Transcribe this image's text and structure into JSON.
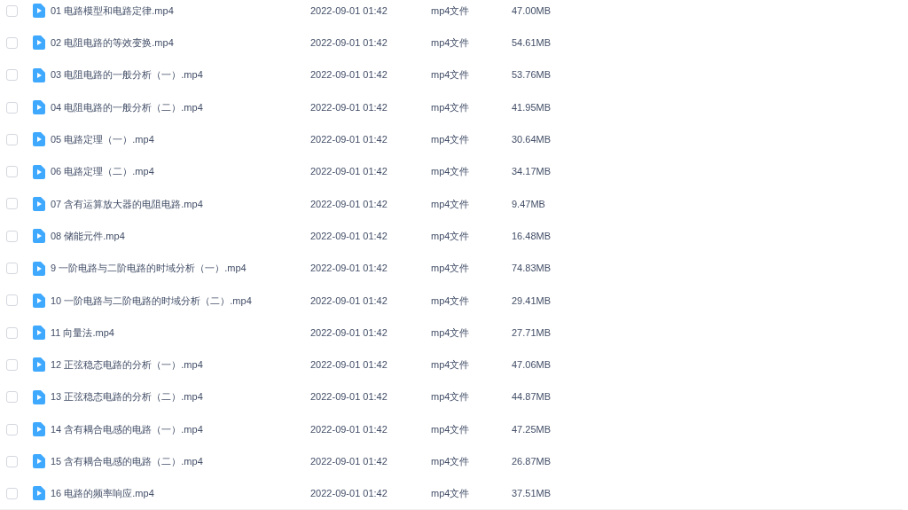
{
  "files": [
    {
      "name": "01 电路模型和电路定律.mp4",
      "modified": "2022-09-01 01:42",
      "type": "mp4文件",
      "size": "47.00MB",
      "checked": false
    },
    {
      "name": "02 电阻电路的等效变换.mp4",
      "modified": "2022-09-01 01:42",
      "type": "mp4文件",
      "size": "54.61MB",
      "checked": false
    },
    {
      "name": "03 电阻电路的一般分析（一）.mp4",
      "modified": "2022-09-01 01:42",
      "type": "mp4文件",
      "size": "53.76MB",
      "checked": false
    },
    {
      "name": "04 电阻电路的一般分析（二）.mp4",
      "modified": "2022-09-01 01:42",
      "type": "mp4文件",
      "size": "41.95MB",
      "checked": false
    },
    {
      "name": "05 电路定理（一）.mp4",
      "modified": "2022-09-01 01:42",
      "type": "mp4文件",
      "size": "30.64MB",
      "checked": false
    },
    {
      "name": "06 电路定理（二）.mp4",
      "modified": "2022-09-01 01:42",
      "type": "mp4文件",
      "size": "34.17MB",
      "checked": false
    },
    {
      "name": "07 含有运算放大器的电阻电路.mp4",
      "modified": "2022-09-01 01:42",
      "type": "mp4文件",
      "size": "9.47MB",
      "checked": false
    },
    {
      "name": "08 储能元件.mp4",
      "modified": "2022-09-01 01:42",
      "type": "mp4文件",
      "size": "16.48MB",
      "checked": false
    },
    {
      "name": "9 一阶电路与二阶电路的时域分析（一）.mp4",
      "modified": "2022-09-01 01:42",
      "type": "mp4文件",
      "size": "74.83MB",
      "checked": false
    },
    {
      "name": "10 一阶电路与二阶电路的时域分析（二）.mp4",
      "modified": "2022-09-01 01:42",
      "type": "mp4文件",
      "size": "29.41MB",
      "checked": false
    },
    {
      "name": "11 向量法.mp4",
      "modified": "2022-09-01 01:42",
      "type": "mp4文件",
      "size": "27.71MB",
      "checked": false
    },
    {
      "name": "12 正弦稳态电路的分析（一）.mp4",
      "modified": "2022-09-01 01:42",
      "type": "mp4文件",
      "size": "47.06MB",
      "checked": false
    },
    {
      "name": "13 正弦稳态电路的分析（二）.mp4",
      "modified": "2022-09-01 01:42",
      "type": "mp4文件",
      "size": "44.87MB",
      "checked": false
    },
    {
      "name": "14 含有耦合电感的电路（一）.mp4",
      "modified": "2022-09-01 01:42",
      "type": "mp4文件",
      "size": "47.25MB",
      "checked": false
    },
    {
      "name": "15 含有耦合电感的电路（二）.mp4",
      "modified": "2022-09-01 01:42",
      "type": "mp4文件",
      "size": "26.87MB",
      "checked": false
    },
    {
      "name": "16 电路的频率响应.mp4",
      "modified": "2022-09-01 01:42",
      "type": "mp4文件",
      "size": "37.51MB",
      "checked": false
    }
  ]
}
